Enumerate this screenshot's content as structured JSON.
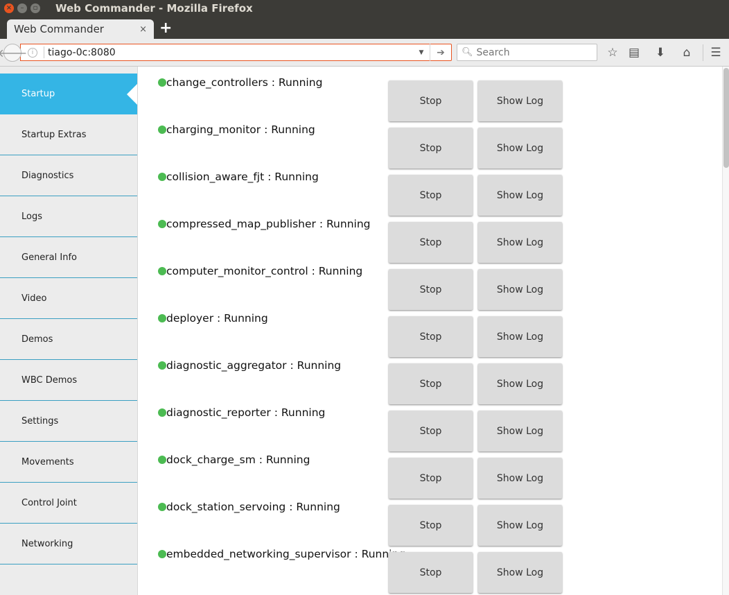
{
  "window": {
    "title": "Web Commander - Mozilla Firefox"
  },
  "browser": {
    "tab_title": "Web Commander",
    "tab_close": "×",
    "new_tab": "+",
    "url": "tiago-0c:8080",
    "search_placeholder": "Search"
  },
  "sidebar": {
    "items": [
      {
        "label": "Startup",
        "active": true
      },
      {
        "label": "Startup Extras"
      },
      {
        "label": "Diagnostics"
      },
      {
        "label": "Logs"
      },
      {
        "label": "General Info"
      },
      {
        "label": "Video"
      },
      {
        "label": "Demos"
      },
      {
        "label": "WBC Demos"
      },
      {
        "label": "Settings"
      },
      {
        "label": "Movements"
      },
      {
        "label": "Control Joint"
      },
      {
        "label": "Networking"
      }
    ]
  },
  "colors": {
    "running": "#4cbb52",
    "active_nav": "#34b5e5",
    "url_focus": "#e95420"
  },
  "processes": [
    {
      "name": "change_controllers",
      "status": "Running",
      "stop_label": "Stop",
      "log_label": "Show Log"
    },
    {
      "name": "charging_monitor",
      "status": "Running",
      "stop_label": "Stop",
      "log_label": "Show Log"
    },
    {
      "name": "collision_aware_fjt",
      "status": "Running",
      "stop_label": "Stop",
      "log_label": "Show Log"
    },
    {
      "name": "compressed_map_publisher",
      "status": "Running",
      "stop_label": "Stop",
      "log_label": "Show Log"
    },
    {
      "name": "computer_monitor_control",
      "status": "Running",
      "stop_label": "Stop",
      "log_label": "Show Log"
    },
    {
      "name": "deployer",
      "status": "Running",
      "stop_label": "Stop",
      "log_label": "Show Log"
    },
    {
      "name": "diagnostic_aggregator",
      "status": "Running",
      "stop_label": "Stop",
      "log_label": "Show Log"
    },
    {
      "name": "diagnostic_reporter",
      "status": "Running",
      "stop_label": "Stop",
      "log_label": "Show Log"
    },
    {
      "name": "dock_charge_sm",
      "status": "Running",
      "stop_label": "Stop",
      "log_label": "Show Log"
    },
    {
      "name": "dock_station_servoing",
      "status": "Running",
      "stop_label": "Stop",
      "log_label": "Show Log"
    },
    {
      "name": "embedded_networking_supervisor",
      "status": "Running",
      "stop_label": "Stop",
      "log_label": "Show Log"
    }
  ]
}
